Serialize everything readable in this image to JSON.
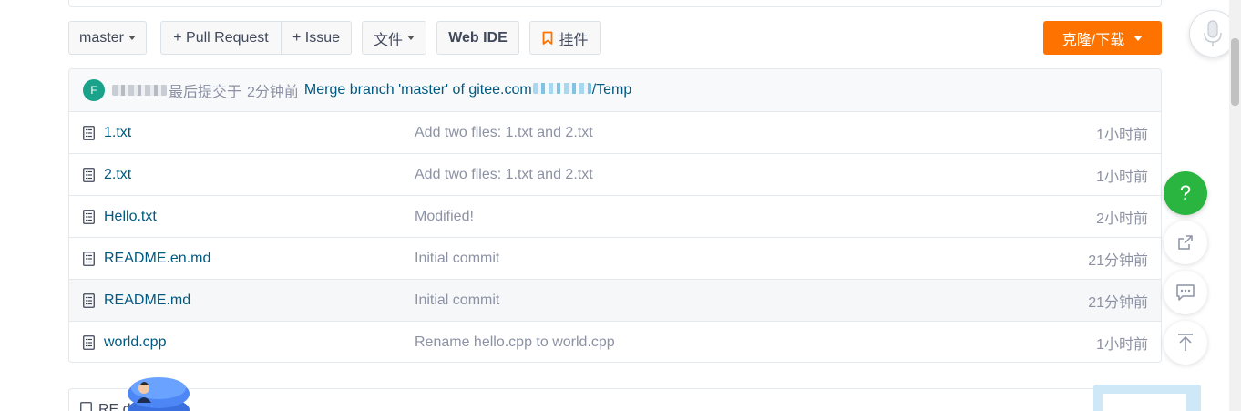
{
  "toolbar": {
    "branch": "master",
    "pull_request": "+ Pull Request",
    "issue": "+ Issue",
    "files_menu": "文件",
    "web_ide": "Web IDE",
    "plugin": "挂件",
    "clone": "克隆/下载"
  },
  "commit_bar": {
    "avatar_letter": "F",
    "last_commit_label": "最后提交于",
    "time": "2分钟前",
    "message_prefix": "Merge branch 'master' of gitee.com",
    "message_suffix": "/Temp"
  },
  "files": [
    {
      "name": "1.txt",
      "message": "Add two files: 1.txt and 2.txt",
      "time": "1小时前"
    },
    {
      "name": "2.txt",
      "message": "Add two files: 1.txt and 2.txt",
      "time": "1小时前"
    },
    {
      "name": "Hello.txt",
      "message": "Modified!",
      "time": "2小时前"
    },
    {
      "name": "README.en.md",
      "message": "Initial commit",
      "time": "21分钟前"
    },
    {
      "name": "README.md",
      "message": "Initial commit",
      "time": "21分钟前"
    },
    {
      "name": "world.cpp",
      "message": "Rename hello.cpp to world.cpp",
      "time": "1小时前"
    }
  ],
  "readme": {
    "label": "RE        d"
  },
  "side_buttons": {
    "help": "?"
  },
  "colors": {
    "accent": "#fe7300",
    "help": "#2ab540",
    "link": "#005980"
  }
}
